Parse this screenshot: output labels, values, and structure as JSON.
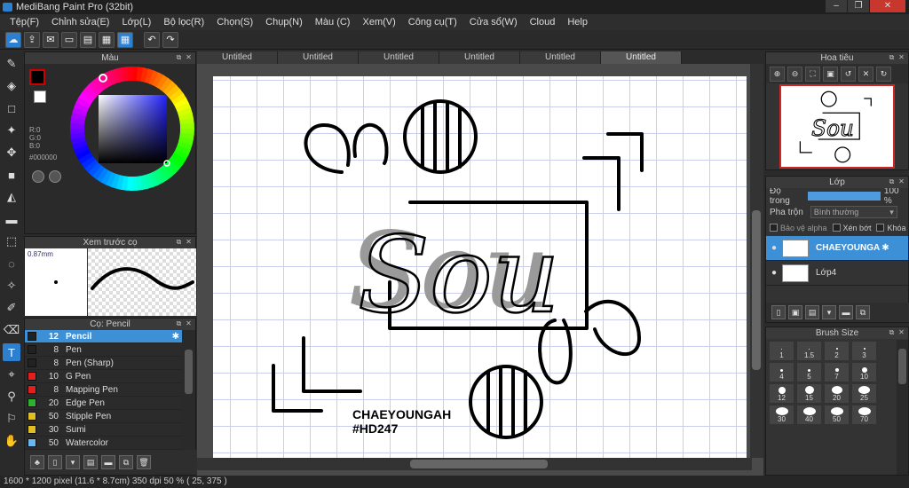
{
  "window": {
    "title": "MediBang Paint Pro (32bit)",
    "controls": [
      "–",
      "❐",
      "✕"
    ]
  },
  "menu": [
    "Tệp(F)",
    "Chỉnh sửa(E)",
    "Lớp(L)",
    "Bộ lọc(R)",
    "Chọn(S)",
    "Chụp(N)",
    "Màu (C)",
    "Xem(V)",
    "Công cụ(T)",
    "Cửa sổ(W)",
    "Cloud",
    "Help"
  ],
  "color_panel": {
    "title": "Màu",
    "r": "R:0",
    "g": "G:0",
    "b": "B:0",
    "hex": "#000000",
    "primary": "#000000",
    "secondary": "#ffffff"
  },
  "brush_preview": {
    "title": "Xem trước cọ",
    "size": "0.87mm"
  },
  "brush_panel": {
    "title": "Cọ: Pencil",
    "items": [
      {
        "size": "12",
        "name": "Pencil",
        "color": "#222222",
        "selected": true
      },
      {
        "size": "8",
        "name": "Pen",
        "color": "#222222"
      },
      {
        "size": "8",
        "name": "Pen (Sharp)",
        "color": "#222222"
      },
      {
        "size": "10",
        "name": "G Pen",
        "color": "#e02020"
      },
      {
        "size": "8",
        "name": "Mapping Pen",
        "color": "#e02020"
      },
      {
        "size": "20",
        "name": "Edge Pen",
        "color": "#30b030"
      },
      {
        "size": "50",
        "name": "Stipple Pen",
        "color": "#e0c020"
      },
      {
        "size": "30",
        "name": "Sumi",
        "color": "#e0c020"
      },
      {
        "size": "50",
        "name": "Watercolor",
        "color": "#6ab7f0"
      }
    ]
  },
  "tabs": [
    "Untitled",
    "Untitled",
    "Untitled",
    "Untitled",
    "Untitled",
    "Untitled"
  ],
  "canvas_text": {
    "sou": "Sou",
    "signature": "CHAEYOUNGAH",
    "tag": "#HD247"
  },
  "navigator": {
    "title": "Hoa tiêu"
  },
  "layer_panel": {
    "title": "Lớp",
    "opacity_label": "Độ trong",
    "opacity_value": "100 %",
    "opacity_percent": 100,
    "blend_label": "Pha trộn",
    "blend_value": "Bình thường",
    "protect_alpha": "Bảo vệ alpha",
    "clip": "Xén bớt",
    "lock": "Khóa",
    "layers": [
      {
        "name": "CHAEYOUNGA",
        "selected": true
      },
      {
        "name": "Lớp4",
        "selected": false
      }
    ]
  },
  "brush_size": {
    "title": "Brush Size",
    "sizes": [
      "1",
      "1.5",
      "2",
      "3",
      "4",
      "5",
      "7",
      "10",
      "12",
      "15",
      "20",
      "25",
      "30",
      "40",
      "50",
      "70"
    ]
  },
  "status": {
    "dimensions": "1600 * 1200 pixel",
    "physical": "(11.6 * 8.7cm)",
    "dpi": "350 dpi",
    "zoom": "50 %",
    "coords": "( 25, 375 )"
  }
}
